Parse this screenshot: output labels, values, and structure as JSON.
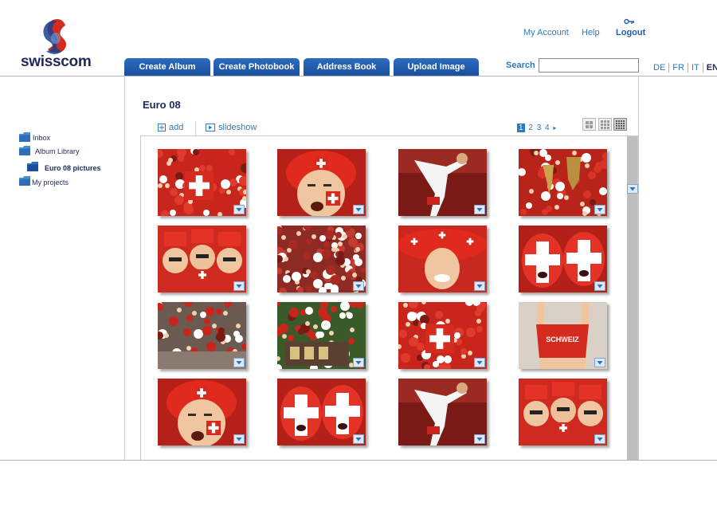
{
  "brand": {
    "name": "swisscom"
  },
  "header": {
    "links": {
      "my_account": "My Account",
      "help": "Help",
      "logout": "Logout"
    },
    "search": {
      "label": "Search",
      "value": ""
    },
    "languages": [
      "DE",
      "FR",
      "IT",
      "EN"
    ],
    "active_language": "EN"
  },
  "tabs": [
    {
      "label": "Create Album"
    },
    {
      "label": "Create Photobook"
    },
    {
      "label": "Address Book"
    },
    {
      "label": "Upload Image"
    }
  ],
  "sidebar": {
    "items": [
      {
        "label": "Inbox",
        "icon": "folder-icon"
      },
      {
        "label": "Album Library",
        "icon": "folder-icon"
      },
      {
        "label": "Euro 08 pictures",
        "icon": "folder-icon",
        "selected": true
      },
      {
        "label": "My projects",
        "icon": "folder-icon"
      }
    ]
  },
  "album": {
    "title": "Euro 08",
    "actions": {
      "add": "add",
      "slideshow": "slideshow"
    },
    "pagination": {
      "pages": [
        "1",
        "2",
        "3",
        "4"
      ],
      "current": "1"
    },
    "view_modes": [
      "large-grid-icon",
      "medium-grid-icon",
      "small-grid-icon"
    ],
    "active_view": "small-grid-icon",
    "photos": [
      {
        "subject": "crowd-flag"
      },
      {
        "subject": "helmet-fan"
      },
      {
        "subject": "player-kick"
      },
      {
        "subject": "fans-trophy"
      },
      {
        "subject": "fans-hats"
      },
      {
        "subject": "crowd-aerial"
      },
      {
        "subject": "sombrero-fan"
      },
      {
        "subject": "face-paint-fans"
      },
      {
        "subject": "fans-street"
      },
      {
        "subject": "fans-table"
      },
      {
        "subject": "crowd-flag"
      },
      {
        "subject": "schweiz-shirt"
      },
      {
        "subject": "helmet-fan"
      },
      {
        "subject": "face-paint-fans"
      },
      {
        "subject": "player-kick"
      },
      {
        "subject": "fans-hats"
      }
    ]
  },
  "colors": {
    "link": "#2f7ab8",
    "tab": "#1f5aa8",
    "title": "#1f2a5a",
    "swiss_red": "#d52b1e"
  }
}
